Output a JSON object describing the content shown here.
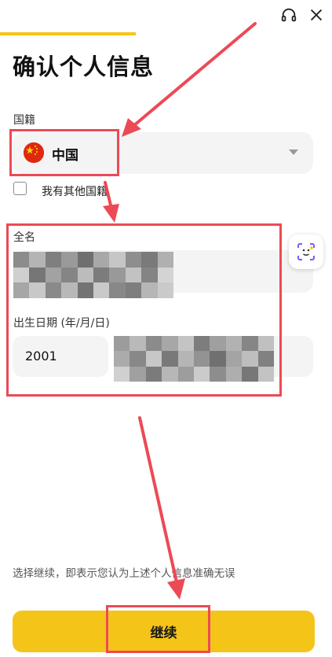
{
  "header": {
    "progress_fraction": 0.41,
    "support_icon": "headset-icon",
    "close_icon": "close-icon"
  },
  "page_title": "确认个人信息",
  "nationality": {
    "label": "国籍",
    "selected_value": "中国",
    "flag_icon": "china-flag-icon",
    "other_checkbox_label": "我有其他国籍",
    "other_checked": false
  },
  "full_name": {
    "label": "全名",
    "value_redacted": true
  },
  "birth_date": {
    "label": "出生日期 (年/月/日)",
    "year": "2001",
    "month_day_redacted": true
  },
  "scan_icon": "face-scan-icon",
  "footer": {
    "disclaimer": "选择继续，即表示您认为上述个人信息准确无误",
    "continue_label": "继续"
  },
  "colors": {
    "accent": "#f5c419",
    "annotation": "#ec4a55",
    "field_bg": "#f4f4f4"
  }
}
